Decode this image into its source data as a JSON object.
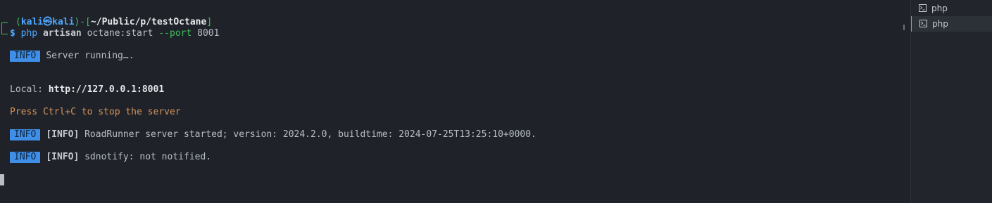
{
  "prompt": {
    "open_paren": "(",
    "user": "kali",
    "at_symbol": "㉿",
    "host": "kali",
    "close_dash": ")-[",
    "path": "~/Public/p/testOctane",
    "close_bracket": "]",
    "dollar": "$",
    "cmd_php": "php",
    "cmd_artisan": "artisan",
    "cmd_action": "octane:start",
    "cmd_flag": "--port",
    "cmd_value": "8001"
  },
  "output": {
    "info1_badge": "INFO",
    "info1_text": "Server running….",
    "local_label": "Local:",
    "local_url": "http://127.0.0.1:8001",
    "press_ctrl": "Press Ctrl+C to stop the server",
    "info2_badge": "INFO",
    "info2_tag": "[INFO]",
    "info2_text": "RoadRunner server started; version: 2024.2.0, buildtime: 2024-07-25T13:25:10+0000.",
    "info3_badge": "INFO",
    "info3_tag": "[INFO]",
    "info3_text": "sdnotify: not notified."
  },
  "sidebar": {
    "tabs": [
      {
        "label": "php",
        "icon": "terminal-icon",
        "active": false
      },
      {
        "label": "php",
        "icon": "terminal-icon",
        "active": true
      }
    ]
  },
  "colors": {
    "background": "#1f2329",
    "accent_green": "#3fbd5f",
    "accent_blue": "#4fa8ff",
    "badge_blue": "#3f8ee8",
    "warning_orange": "#d5935b"
  }
}
